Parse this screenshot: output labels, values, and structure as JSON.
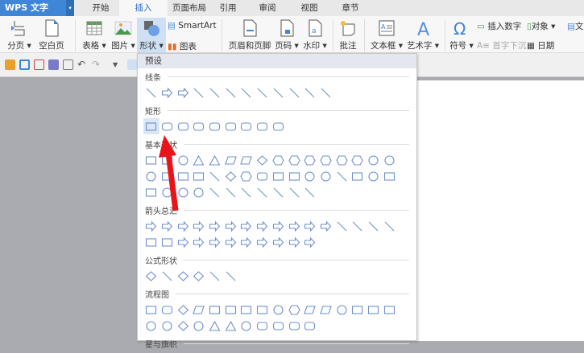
{
  "app": {
    "logo": "WPS 文字",
    "dropdown": "▾"
  },
  "tabs": [
    "开始",
    "插入",
    "页面布局",
    "引用",
    "审阅",
    "视图",
    "章节"
  ],
  "active_tab": "插入",
  "ribbon": {
    "page_break": "分页 ▾",
    "blank_page": "空白页 ▾",
    "table": "表格 ▾",
    "picture": "图片 ▾",
    "shape": "形状 ▾",
    "smartart": "SmartArt",
    "chart": "图表",
    "header_footer": "页眉和页脚",
    "page_number": "页码 ▾",
    "watermark": "水印 ▾",
    "comment": "批注",
    "textbox": "文本框 ▾",
    "wordart": "艺术字 ▾",
    "symbol": "符号 ▾",
    "insert_number": "插入数字",
    "object": "对象 ▾",
    "text_partial": "文",
    "drop_cap": "首字下沉",
    "date": "日期"
  },
  "menu": {
    "preset": "预设",
    "sections": [
      {
        "title": "线条",
        "shapes": [
          "line",
          "arrow",
          "double-arrow",
          "elbow",
          "elbow-arrow",
          "elbow-double-arrow",
          "curve",
          "curve-arrow",
          "curve-double-arrow",
          "s-curve",
          "freeform",
          "scribble"
        ]
      },
      {
        "title": "矩形",
        "shapes": [
          "rect",
          "rounded",
          "snip1",
          "snip2",
          "snip-diag",
          "snip-round",
          "round1",
          "round2",
          "round-diag"
        ]
      },
      {
        "title": "基本形状",
        "shapes": [
          "textbox",
          "rect",
          "circle",
          "triangle",
          "right-triangle",
          "parallelogram",
          "trapezoid",
          "diamond",
          "pentagon",
          "hexagon",
          "heptagon",
          "octagon",
          "decagon",
          "dodecagon",
          "pie",
          "chord",
          "teardrop",
          "frame",
          "half-frame",
          "l-shape",
          "diagonal",
          "plus",
          "octagon",
          "can",
          "cube",
          "bevel",
          "donut",
          "no-symbol",
          "arc",
          "folded",
          "smiley",
          "heart",
          "lightning",
          "sun",
          "moon",
          "cloud",
          "arc",
          "bracket-pair",
          "brace-pair",
          "left-bracket",
          "right-bracket",
          "left-brace",
          "right-brace"
        ]
      },
      {
        "title": "箭头总汇",
        "shapes": [
          "right-arrow",
          "left-arrow",
          "up-arrow",
          "down-arrow",
          "left-right-arrow",
          "up-down-arrow",
          "quad-arrow",
          "left-right-up-arrow",
          "bent-arrow",
          "u-turn",
          "left-up-arrow",
          "bent-up-arrow",
          "curved-right",
          "curved-left",
          "curved-up",
          "curved-down",
          "striped-right",
          "notched-right",
          "pentagon-arrow",
          "chevron",
          "right-callout",
          "left-callout",
          "up-callout",
          "down-callout",
          "lr-callout",
          "quad-callout",
          "circular-arrow"
        ]
      },
      {
        "title": "公式形状",
        "shapes": [
          "plus",
          "minus",
          "multiply",
          "divide",
          "equal",
          "not-equal"
        ]
      },
      {
        "title": "流程图",
        "shapes": [
          "rect",
          "rounded",
          "diamond",
          "parallelogram",
          "predefined",
          "internal",
          "document",
          "multidoc",
          "terminator",
          "preparation",
          "manual-input",
          "manual-op",
          "circle",
          "offpage",
          "card",
          "tape",
          "sum",
          "or",
          "collate",
          "sort",
          "merge",
          "extract",
          "stored",
          "delay",
          "magnetic",
          "direct",
          "display"
        ]
      },
      {
        "title": "星与旗帜",
        "shapes": []
      }
    ]
  },
  "colors": {
    "accent": "#3f86d6",
    "arrow": "#e8141a",
    "shape_stroke": "#6f8fce"
  }
}
